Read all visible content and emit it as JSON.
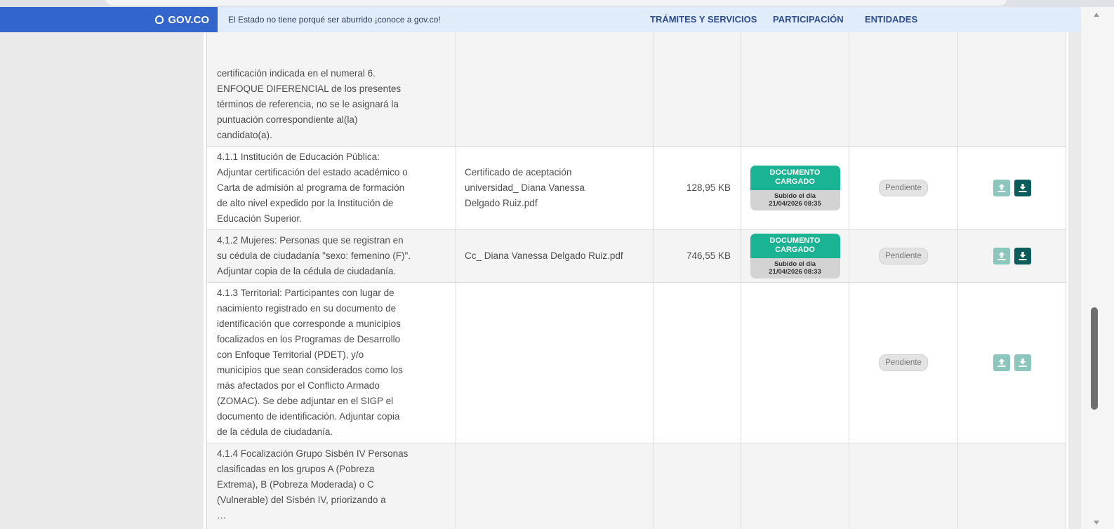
{
  "gov_bar": {
    "logo_text": "GOV.CO",
    "slogan": "El Estado no tiene porqué ser aburrido ¡conoce a gov.co!",
    "menu": [
      "TRÁMITES Y SERVICIOS",
      "PARTICIPACIÓN",
      "ENTIDADES"
    ]
  },
  "rows": [
    {
      "requirement_lines": [
        "certificación indicada en el numeral 6.",
        "ENFOQUE DIFERENCIAL de los presentes",
        "términos de referencia, no se le asignará la",
        "puntuación correspondiente al(la)",
        "candidato(a)."
      ],
      "file_lines": [],
      "size": "",
      "loaded": false,
      "status_label": "",
      "uploaded_label": "",
      "uploaded_date": "",
      "review": "",
      "actions": false,
      "download_enabled": false
    },
    {
      "requirement_lines": [
        "4.1.1 Institución de Educación Pública:",
        "Adjuntar certificación del estado académico o",
        "Carta de admisión al programa de formación",
        "de alto nivel expedido por la Institución de",
        "Educación Superior."
      ],
      "file_lines": [
        "Certificado de aceptación",
        "universidad_ Diana Vanessa",
        "Delgado Ruiz.pdf"
      ],
      "size": "128,95 KB",
      "loaded": true,
      "status_label": "DOCUMENTO CARGADO",
      "uploaded_label": "Subido el día",
      "uploaded_date": "21/04/2026 08:35",
      "review": "Pendiente",
      "actions": true,
      "download_enabled": true
    },
    {
      "requirement_lines": [
        "4.1.2 Mujeres: Personas que se registran en",
        "su cédula de ciudadanía \"sexo: femenino (F)\".",
        "Adjuntar copia de la cédula de ciudadanía."
      ],
      "file_lines": [
        "Cc_ Diana Vanessa Delgado Ruiz.pdf"
      ],
      "size": "746,55 KB",
      "loaded": true,
      "status_label": "DOCUMENTO CARGADO",
      "uploaded_label": "Subido el día",
      "uploaded_date": "21/04/2026 08:33",
      "review": "Pendiente",
      "actions": true,
      "download_enabled": true
    },
    {
      "requirement_lines": [
        "4.1.3 Territorial: Participantes con lugar de",
        "nacimiento registrado en su documento de",
        "identificación que corresponde a municipios",
        "focalizados en los Programas de Desarrollo",
        "con Enfoque Territorial (PDET), y/o",
        "municipios que sean considerados como los",
        "más afectados por el Conflicto Armado",
        "(ZOMAC). Se debe adjuntar en el SIGP el",
        "documento de identificación. Adjuntar copia",
        "de la cédula de ciudadanía."
      ],
      "file_lines": [],
      "size": "",
      "loaded": false,
      "status_label": "",
      "uploaded_label": "",
      "uploaded_date": "",
      "review": "Pendiente",
      "actions": true,
      "download_enabled": false
    },
    {
      "requirement_lines": [
        "4.1.4 Focalización Grupo Sisbén IV Personas",
        "clasificadas en los grupos A (Pobreza",
        "Extrema), B (Pobreza Moderada) o C",
        "(Vulnerable) del Sisbén IV, priorizando a",
        "…"
      ],
      "file_lines": [],
      "size": "",
      "loaded": false,
      "status_label": "",
      "uploaded_label": "",
      "uploaded_date": "",
      "review": "",
      "actions": false,
      "download_enabled": false
    }
  ],
  "icons": {
    "upload": "upload-icon",
    "download": "download-icon",
    "logo": "gov-co-logo-icon"
  },
  "colors": {
    "gov_blue": "#3366cc",
    "gov_bar_bg": "#e1ecfb",
    "status_green": "#1ab394",
    "download_teal": "#0a5c5c",
    "upload_teal_light": "#8cc6bd"
  }
}
